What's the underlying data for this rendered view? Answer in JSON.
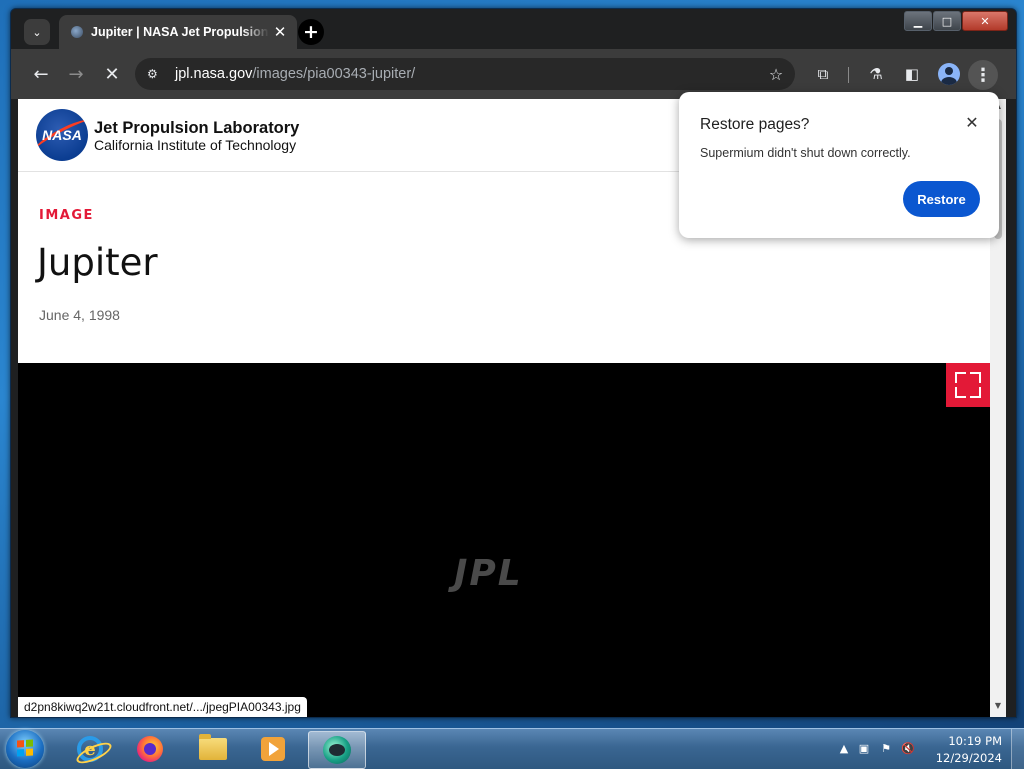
{
  "browser": {
    "tab": {
      "title": "Jupiter | NASA Jet Propulsion Laboratory",
      "close_glyph": "✕",
      "favicon": "jpl-favicon-icon"
    },
    "tab_search_glyph": "⌄",
    "new_tab_glyph": "+",
    "window_controls": {
      "minimize": "▁",
      "maximize": "□",
      "close": "✕"
    },
    "nav": {
      "back": "←",
      "forward": "→",
      "stop": "✕"
    },
    "url_host": "jpl.nasa.gov",
    "url_path": "/images/pia00343-jupiter/",
    "icons": {
      "site_settings": "⚙",
      "bookmark": "☆",
      "extensions": "⧉",
      "labs": "⚗",
      "side_panel": "◧",
      "menu": "⋮"
    }
  },
  "site": {
    "logo_text": "NASA",
    "lab_name": "Jet Propulsion Laboratory",
    "lab_subtitle": "California Institute of Technology"
  },
  "page": {
    "kicker": "IMAGE",
    "title": "Jupiter",
    "date": "June 4, 1998",
    "watermark": "JPL",
    "status_url": "d2pn8kiwq2w21t.cloudfront.net/.../jpegPIA00343.jpg",
    "accent_color": "#e31937"
  },
  "restore_dialog": {
    "title": "Restore pages?",
    "message": "Supermium didn't shut down correctly.",
    "button": "Restore",
    "close_glyph": "✕",
    "button_color": "#0b57d0"
  },
  "taskbar": {
    "apps": [
      "internet-explorer-icon",
      "firefox-icon",
      "file-explorer-icon",
      "media-player-icon",
      "supermium-icon"
    ],
    "tray_glyphs": {
      "arrow": "▲",
      "network": "▣",
      "flag": "⚑",
      "volume": "🔇"
    },
    "time": "10:19 PM",
    "date": "12/29/2024"
  }
}
